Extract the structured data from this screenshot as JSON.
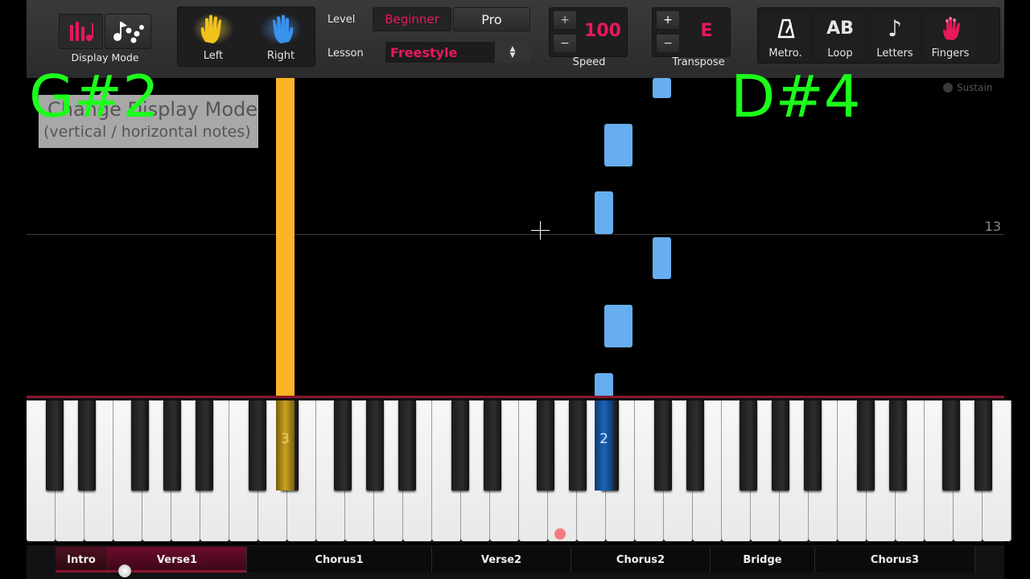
{
  "toolbar": {
    "display_mode_label": "Display Mode",
    "hands": {
      "left": "Left",
      "right": "Right"
    },
    "level": {
      "label": "Level",
      "options": [
        "Beginner",
        "Pro"
      ],
      "selected": "Beginner"
    },
    "lesson": {
      "label": "Lesson",
      "value": "Freestyle"
    },
    "speed": {
      "plus": "+",
      "minus": "−",
      "value": "100",
      "label": "Speed"
    },
    "transpose": {
      "plus": "+",
      "minus": "−",
      "value": "E",
      "label": "Transpose"
    },
    "tools": [
      {
        "label": "Metro.",
        "glyph": "♁",
        "icon": "metronome-icon"
      },
      {
        "label": "Loop",
        "glyph": "AB",
        "icon": "loop-icon"
      },
      {
        "label": "Letters",
        "glyph": "♪",
        "icon": "letters-note-icon"
      },
      {
        "label": "Fingers",
        "glyph": "",
        "icon": "fingers-hand-icon"
      }
    ]
  },
  "tooltip": {
    "line1": "Change Display Mode",
    "line2": "(vertical / horizontal notes)"
  },
  "roll": {
    "sustain_label": "Sustain",
    "measure_number": "13"
  },
  "keys": {
    "left_finger": "3",
    "right_finger": "2"
  },
  "overlays": {
    "left_note": "G#2",
    "right_note": "D#4"
  },
  "sections": [
    "Intro",
    "Verse1",
    "Chorus1",
    "Verse2",
    "Chorus2",
    "Bridge",
    "Chorus3"
  ],
  "active_section": "Verse1",
  "colors": {
    "accent": "#e8185a",
    "left_hand": "#f2b52a",
    "right_hand": "#67aef0",
    "overlay": "#1bff1b"
  }
}
